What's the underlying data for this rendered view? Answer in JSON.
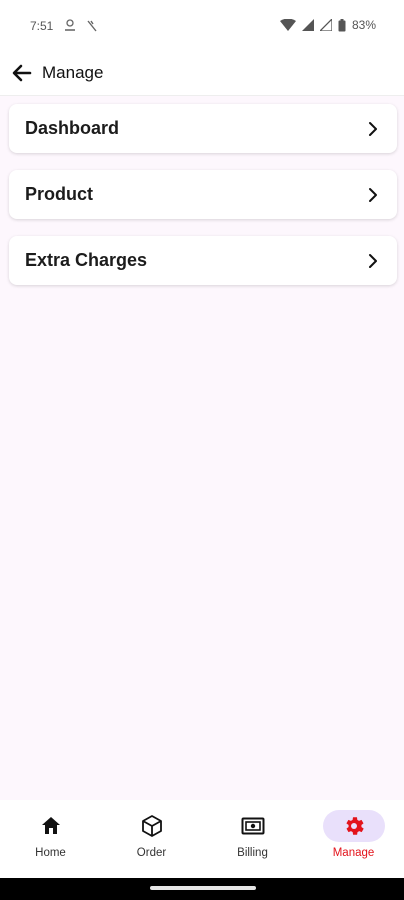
{
  "status_bar": {
    "time": "7:51",
    "battery": "83%"
  },
  "app_bar": {
    "title": "Manage"
  },
  "menu": {
    "items": [
      {
        "label": "Dashboard"
      },
      {
        "label": "Product"
      },
      {
        "label": "Extra Charges"
      }
    ]
  },
  "bottom_nav": {
    "items": [
      {
        "label": "Home",
        "icon": "home-icon",
        "active": false
      },
      {
        "label": "Order",
        "icon": "cube-icon",
        "active": false
      },
      {
        "label": "Billing",
        "icon": "billing-icon",
        "active": false
      },
      {
        "label": "Manage",
        "icon": "gear-icon",
        "active": true
      }
    ]
  },
  "colors": {
    "accent": "#e3131b",
    "active_pill": "#e9e0fb",
    "background": "#fdf7fd"
  }
}
